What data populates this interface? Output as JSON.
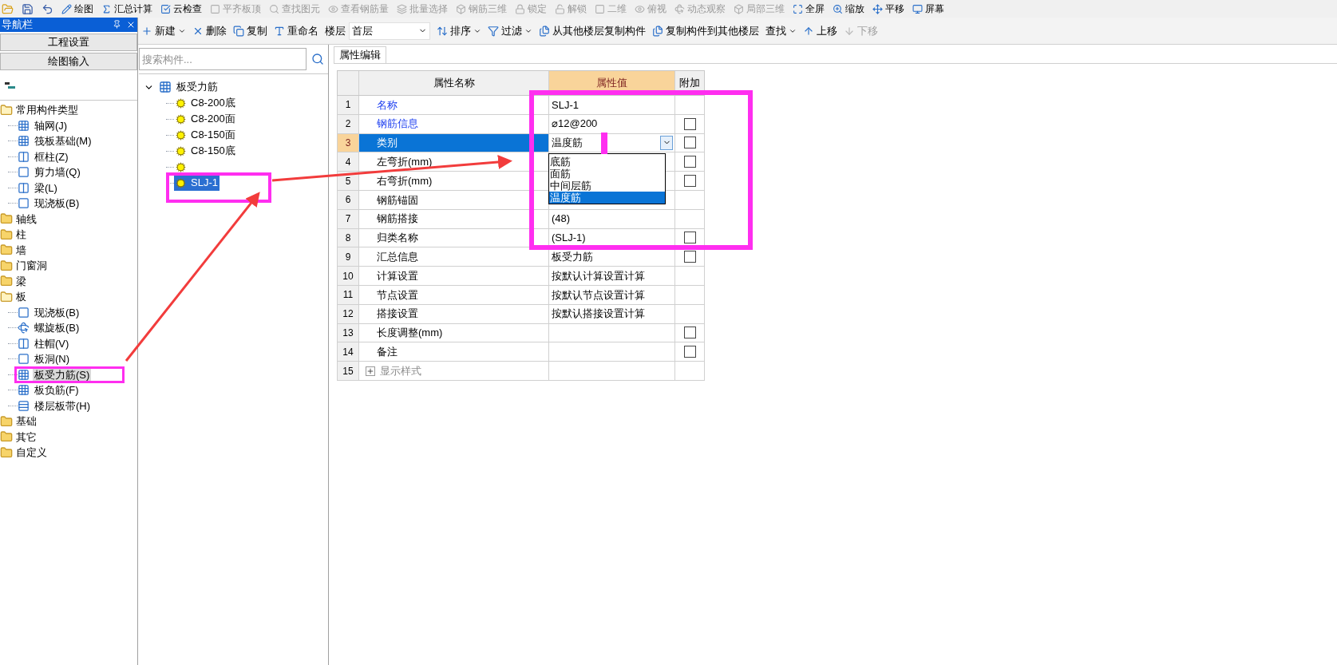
{
  "top_toolbar": [
    {
      "label": "绘图",
      "disabled": false
    },
    {
      "label": "汇总计算",
      "disabled": false
    },
    {
      "label": "云检查",
      "disabled": false
    },
    {
      "label": "平齐板顶",
      "disabled": true
    },
    {
      "label": "查找图元",
      "disabled": true
    },
    {
      "label": "查看钢筋量",
      "disabled": true
    },
    {
      "label": "批量选择",
      "disabled": true
    },
    {
      "label": "钢筋三维",
      "disabled": true
    },
    {
      "label": "锁定",
      "disabled": true
    },
    {
      "label": "解锁",
      "disabled": true
    },
    {
      "label": "二维",
      "disabled": true
    },
    {
      "label": "俯视",
      "disabled": true
    },
    {
      "label": "动态观察",
      "disabled": true
    },
    {
      "label": "局部三维",
      "disabled": true
    },
    {
      "label": "全屏",
      "disabled": false
    },
    {
      "label": "缩放",
      "disabled": false
    },
    {
      "label": "平移",
      "disabled": false
    },
    {
      "label": "屏幕",
      "disabled": false
    }
  ],
  "nav": {
    "title": "导航栏",
    "buttons": [
      "工程设置",
      "绘图输入"
    ],
    "tree": [
      {
        "label": "常用构件类型",
        "expanded": true,
        "children": [
          {
            "label": "轴网(J)",
            "selected": false
          },
          {
            "label": "筏板基础(M)",
            "selected": false
          },
          {
            "label": "框柱(Z)",
            "selected": false
          },
          {
            "label": "剪力墙(Q)",
            "selected": false
          },
          {
            "label": "梁(L)",
            "selected": false
          },
          {
            "label": "现浇板(B)",
            "selected": false
          }
        ]
      },
      {
        "label": "轴线",
        "expanded": false
      },
      {
        "label": "柱",
        "expanded": false
      },
      {
        "label": "墙",
        "expanded": false
      },
      {
        "label": "门窗洞",
        "expanded": false
      },
      {
        "label": "梁",
        "expanded": false
      },
      {
        "label": "板",
        "expanded": true,
        "children": [
          {
            "label": "现浇板(B)",
            "selected": false
          },
          {
            "label": "螺旋板(B)",
            "selected": false
          },
          {
            "label": "柱帽(V)",
            "selected": false
          },
          {
            "label": "板洞(N)",
            "selected": false
          },
          {
            "label": "板受力筋(S)",
            "selected": true
          },
          {
            "label": "板负筋(F)",
            "selected": false
          },
          {
            "label": "楼层板带(H)",
            "selected": false
          }
        ]
      },
      {
        "label": "基础",
        "expanded": false
      },
      {
        "label": "其它",
        "expanded": false
      },
      {
        "label": "自定义",
        "expanded": false
      }
    ]
  },
  "toolbar": [
    {
      "label": "新建",
      "kind": "menu",
      "disabled": false
    },
    {
      "label": "删除",
      "kind": "button",
      "disabled": false
    },
    {
      "label": "复制",
      "kind": "button",
      "disabled": false
    },
    {
      "label": "重命名",
      "kind": "button",
      "disabled": false
    },
    {
      "label": "楼层",
      "kind": "select",
      "value": "首层"
    },
    {
      "label": "排序",
      "kind": "menu",
      "disabled": false
    },
    {
      "label": "过滤",
      "kind": "menu",
      "disabled": false
    },
    {
      "label": "从其他楼层复制构件",
      "kind": "button",
      "disabled": false
    },
    {
      "label": "复制构件到其他楼层",
      "kind": "button",
      "disabled": false
    },
    {
      "label": "查找",
      "kind": "menu",
      "disabled": false
    },
    {
      "label": "上移",
      "kind": "button",
      "disabled": false
    },
    {
      "label": "下移",
      "kind": "button",
      "disabled": true
    }
  ],
  "component_list": {
    "search": {
      "placeholder": "搜索构件..."
    },
    "root": {
      "label": "板受力筋",
      "expanded": true,
      "children": [
        {
          "label": "C8-200底",
          "selected": false
        },
        {
          "label": "C8-200面",
          "selected": false
        },
        {
          "label": "C8-150面",
          "selected": false
        },
        {
          "label": "C8-150底",
          "selected": false
        },
        {
          "selected": false
        },
        {
          "label": "SLJ-1",
          "selected": true
        }
      ]
    }
  },
  "property_editor": {
    "tab": "属性编辑",
    "columns": [
      "属性名称",
      "属性值",
      "附加"
    ],
    "rows": [
      {
        "number": "1",
        "name": "名称",
        "link": true,
        "value": "SLJ-1",
        "selected": false
      },
      {
        "number": "2",
        "name": "钢筋信息",
        "link": true,
        "value": "⌀12@200",
        "checked": false,
        "selected": false
      },
      {
        "number": "3",
        "name": "类别",
        "link": false,
        "value": "温度筋",
        "dropdown": true,
        "checked": false,
        "selected": true
      },
      {
        "number": "4",
        "name": "左弯折(mm)",
        "link": false,
        "checked": false,
        "selected": false
      },
      {
        "number": "5",
        "name": "右弯折(mm)",
        "link": false,
        "checked": false,
        "selected": false
      },
      {
        "number": "6",
        "name": "钢筋锚固",
        "link": false,
        "selected": false
      },
      {
        "number": "7",
        "name": "钢筋搭接",
        "link": false,
        "value": "(48)",
        "selected": false
      },
      {
        "number": "8",
        "name": "归类名称",
        "link": false,
        "value": "(SLJ-1)",
        "checked": false,
        "selected": false
      },
      {
        "number": "9",
        "name": "汇总信息",
        "link": false,
        "value": "板受力筋",
        "checked": false,
        "selected": false
      },
      {
        "number": "10",
        "name": "计算设置",
        "link": false,
        "value": "按默认计算设置计算",
        "selected": false
      },
      {
        "number": "11",
        "name": "节点设置",
        "link": false,
        "value": "按默认节点设置计算",
        "selected": false
      },
      {
        "number": "12",
        "name": "搭接设置",
        "link": false,
        "value": "按默认搭接设置计算",
        "selected": false
      },
      {
        "number": "13",
        "name": "长度调整(mm)",
        "link": false,
        "checked": false,
        "selected": false
      },
      {
        "number": "14",
        "name": "备注",
        "link": false,
        "checked": false,
        "selected": false
      },
      {
        "number": "15",
        "name": "显示样式",
        "group": true,
        "selected": false
      }
    ],
    "dropdown_options": [
      {
        "label": "底筋",
        "selected": false
      },
      {
        "label": "面筋",
        "selected": false
      },
      {
        "label": "中间层筋",
        "selected": false
      },
      {
        "label": "温度筋",
        "selected": true
      }
    ]
  }
}
